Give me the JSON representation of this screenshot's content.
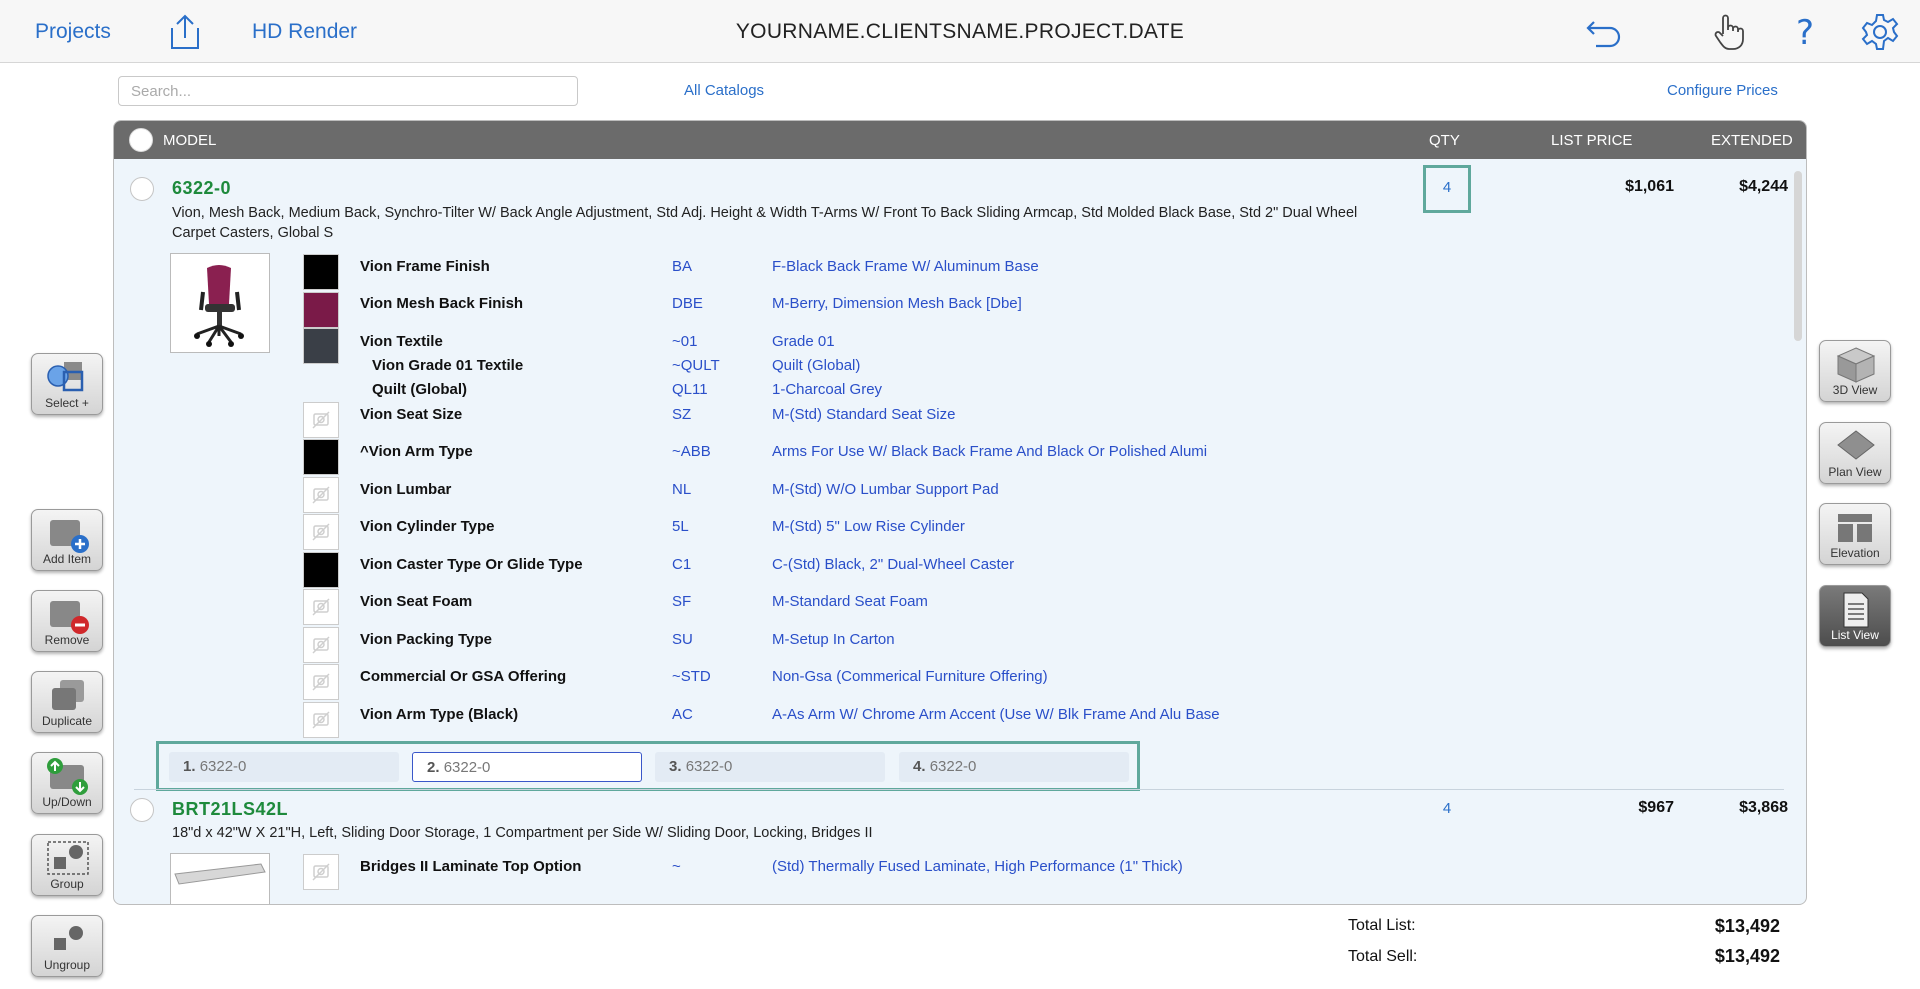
{
  "topbar": {
    "projects": "Projects",
    "hd_render": "HD Render",
    "title": "YOURNAME.CLIENTSNAME.PROJECT.DATE"
  },
  "search": {
    "placeholder": "Search..."
  },
  "catalogs": "All Catalogs",
  "configure": "Configure Prices",
  "table": {
    "headers": {
      "model": "MODEL",
      "qty": "QTY",
      "list": "LIST PRICE",
      "extended": "EXTENDED"
    }
  },
  "items": [
    {
      "model": "6322-0",
      "desc1": "Vion, Mesh Back, Medium Back, Synchro-Tilter W/ Back Angle Adjustment, Std Adj. Height & Width T-Arms W/ Front To Back Sliding Armcap, Std Molded Black Base, Std 2\" Dual Wheel",
      "desc2": "Carpet Casters, Global S",
      "qty": "4",
      "list": "$1,061",
      "extended": "$4,244",
      "options": [
        {
          "name": "Vion Frame Finish",
          "code": "BA",
          "value": "F-Black Back Frame W/ Aluminum Base"
        },
        {
          "name": "Vion Mesh Back Finish",
          "code": "DBE",
          "value": "M-Berry, Dimension Mesh Back [Dbe]"
        },
        {
          "name": "Vion Textile",
          "code": "~01",
          "value": "Grade 01"
        },
        {
          "name": "Vion Grade 01 Textile",
          "code": "~QULT",
          "value": "Quilt (Global)"
        },
        {
          "name": "Quilt (Global)",
          "code": "QL11",
          "value": "1-Charcoal Grey"
        },
        {
          "name": "Vion Seat Size",
          "code": "SZ",
          "value": "M-(Std) Standard Seat Size"
        },
        {
          "name": "^Vion Arm Type",
          "code": "~ABB",
          "value": "Arms For Use W/ Black Back Frame And Black Or Polished Alumi"
        },
        {
          "name": "Vion Lumbar",
          "code": "NL",
          "value": "M-(Std) W/O Lumbar Support Pad"
        },
        {
          "name": "Vion Cylinder Type",
          "code": "5L",
          "value": "M-(Std) 5\" Low Rise Cylinder"
        },
        {
          "name": "Vion Caster Type Or Glide Type",
          "code": "C1",
          "value": "C-(Std) Black, 2\" Dual-Wheel Caster"
        },
        {
          "name": "Vion Seat Foam",
          "code": "SF",
          "value": "M-Standard Seat Foam"
        },
        {
          "name": "Vion Packing Type",
          "code": "SU",
          "value": "M-Setup In Carton"
        },
        {
          "name": "Commercial Or GSA Offering",
          "code": "~STD",
          "value": "Non-Gsa (Commerical Furniture Offering)"
        },
        {
          "name": "Vion Arm Type (Black)",
          "code": "AC",
          "value": "A-As Arm W/ Chrome Arm Accent (Use W/ Blk Frame And Alu Base"
        }
      ],
      "instances": [
        {
          "num": "1.",
          "label": "6322-0"
        },
        {
          "num": "2.",
          "label": "6322-0"
        },
        {
          "num": "3.",
          "label": "6322-0"
        },
        {
          "num": "4.",
          "label": "6322-0"
        }
      ]
    },
    {
      "model": "BRT21LS42L",
      "desc1": "18\"d x 42\"W X 21\"H, Left, Sliding Door Storage, 1 Compartment per Side W/ Sliding Door, Locking, Bridges II",
      "qty": "4",
      "list": "$967",
      "extended": "$3,868",
      "options": [
        {
          "name": "Bridges II Laminate Top Option",
          "code": "~",
          "value": "(Std) Thermally Fused Laminate, High Performance (1\" Thick)"
        }
      ]
    }
  ],
  "left_buttons": {
    "select": "Select +",
    "add": "Add Item",
    "remove": "Remove",
    "duplicate": "Duplicate",
    "updown": "Up/Down",
    "group": "Group",
    "ungroup": "Ungroup"
  },
  "right_buttons": {
    "view3d": "3D View",
    "plan": "Plan View",
    "elevation": "Elevation",
    "list": "List View"
  },
  "totals": {
    "list_label": "Total List:",
    "list_value": "$13,492",
    "sell_label": "Total Sell:",
    "sell_value": "$13,492"
  },
  "colors": {
    "accent_blue": "#2a6fc9",
    "model_green": "#1e8a3c",
    "highlight_teal": "#5fa89c",
    "header_gray": "#6b6b6b"
  }
}
